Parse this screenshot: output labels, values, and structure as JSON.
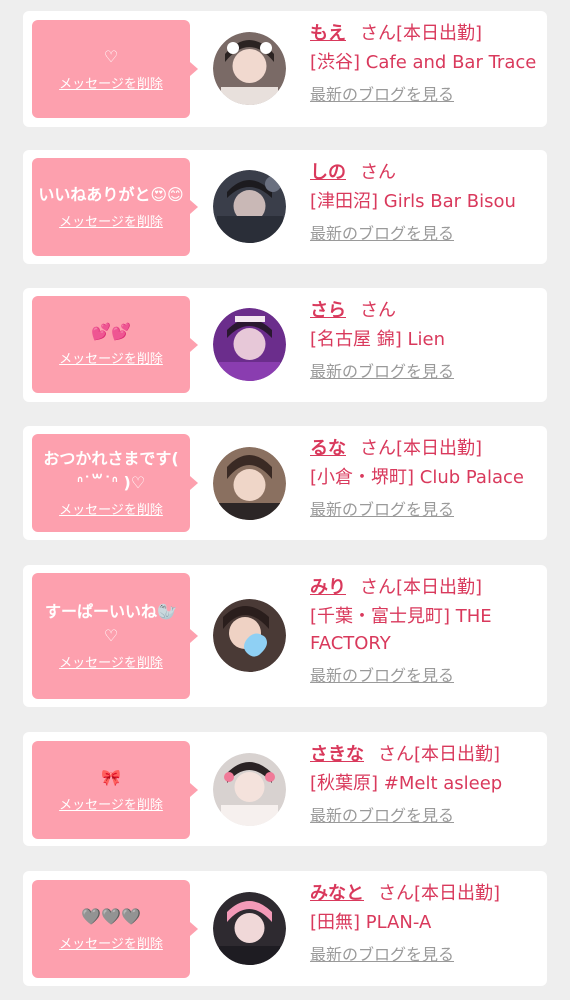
{
  "common": {
    "delete_label": "メッセージを削除",
    "san_label": "さん",
    "blog_label": "最新のブログを見る"
  },
  "colors": {
    "bubble": "#fda0ae",
    "accent": "#d9395c",
    "muted": "#9a9a9a"
  },
  "items": [
    {
      "message": "♡",
      "name": "もえ",
      "status": "[本日出勤]",
      "shop": "[渋谷] Cafe and Bar Trace"
    },
    {
      "message": "いいねありがと😍😊",
      "name": "しの",
      "status": "",
      "shop": "[津田沼] Girls Bar Bisou"
    },
    {
      "message": "💕💕",
      "name": "さら",
      "status": "",
      "shop": "[名古屋 錦] Lien"
    },
    {
      "message": "おつかれさまです( ᐢ˙꒳˙ᐢ )♡",
      "name": "るな",
      "status": "[本日出勤]",
      "shop": "[小倉・堺町] Club Palace"
    },
    {
      "message": "すーぱーいいね🦭♡",
      "name": "みり",
      "status": "[本日出勤]",
      "shop": "[千葉・富士見町] THE FACTORY"
    },
    {
      "message": "🎀",
      "name": "さきな",
      "status": "[本日出勤]",
      "shop": "[秋葉原] #Melt asleep"
    },
    {
      "message": "🩶🩶🩶",
      "name": "みなと",
      "status": "[本日出勤]",
      "shop": "[田無] PLAN-A"
    }
  ]
}
